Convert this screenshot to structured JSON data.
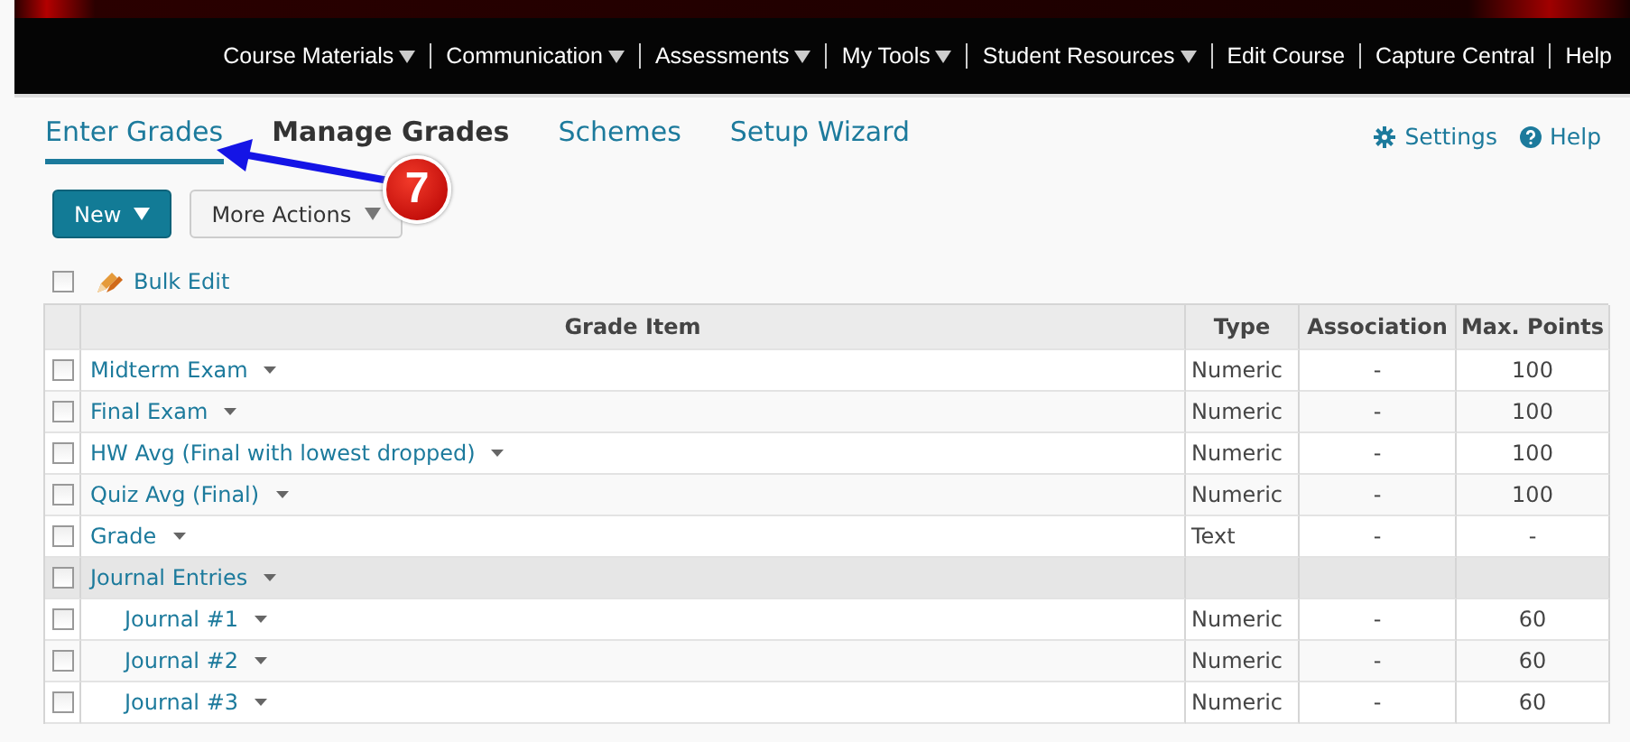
{
  "nav": [
    {
      "label": "Course Materials",
      "has_menu": true
    },
    {
      "label": "Communication",
      "has_menu": true
    },
    {
      "label": "Assessments",
      "has_menu": true
    },
    {
      "label": "My Tools",
      "has_menu": true
    },
    {
      "label": "Student Resources",
      "has_menu": true
    },
    {
      "label": "Edit Course",
      "has_menu": false
    },
    {
      "label": "Capture Central",
      "has_menu": false
    },
    {
      "label": "Help",
      "has_menu": false
    }
  ],
  "tabs": [
    {
      "label": "Enter Grades",
      "selected": false,
      "underlined": true
    },
    {
      "label": "Manage Grades",
      "selected": true,
      "underlined": false
    },
    {
      "label": "Schemes",
      "selected": false,
      "underlined": false
    },
    {
      "label": "Setup Wizard",
      "selected": false,
      "underlined": false
    }
  ],
  "header_links": [
    {
      "kind": "settings",
      "label": "Settings"
    },
    {
      "kind": "help",
      "label": "Help"
    }
  ],
  "annotation": {
    "badge": "7"
  },
  "buttons": [
    {
      "kind": "primary",
      "label": "New"
    },
    {
      "kind": "secondary",
      "label": "More Actions"
    }
  ],
  "bulk_edit": {
    "label": "Bulk Edit",
    "checked": false
  },
  "table": {
    "columns": [
      "Grade Item",
      "Type",
      "Association",
      "Max. Points"
    ],
    "rows": [
      {
        "name": "Midterm Exam",
        "type": "Numeric",
        "association": "-",
        "max_points": "100",
        "checked": false
      },
      {
        "name": "Final Exam",
        "type": "Numeric",
        "association": "-",
        "max_points": "100",
        "checked": false
      },
      {
        "name": "HW Avg (Final with lowest dropped)",
        "type": "Numeric",
        "association": "-",
        "max_points": "100",
        "checked": false
      },
      {
        "name": "Quiz Avg (Final)",
        "type": "Numeric",
        "association": "-",
        "max_points": "100",
        "checked": false
      },
      {
        "name": "Grade",
        "type": "Text",
        "association": "-",
        "max_points": "-",
        "checked": false
      },
      {
        "name": "Journal Entries",
        "checked": false,
        "children": [
          {
            "name": "Journal #1",
            "type": "Numeric",
            "association": "-",
            "max_points": "60",
            "checked": false
          },
          {
            "name": "Journal #2",
            "type": "Numeric",
            "association": "-",
            "max_points": "60",
            "checked": false
          },
          {
            "name": "Journal #3",
            "type": "Numeric",
            "association": "-",
            "max_points": "60",
            "checked": false
          }
        ]
      }
    ]
  }
}
